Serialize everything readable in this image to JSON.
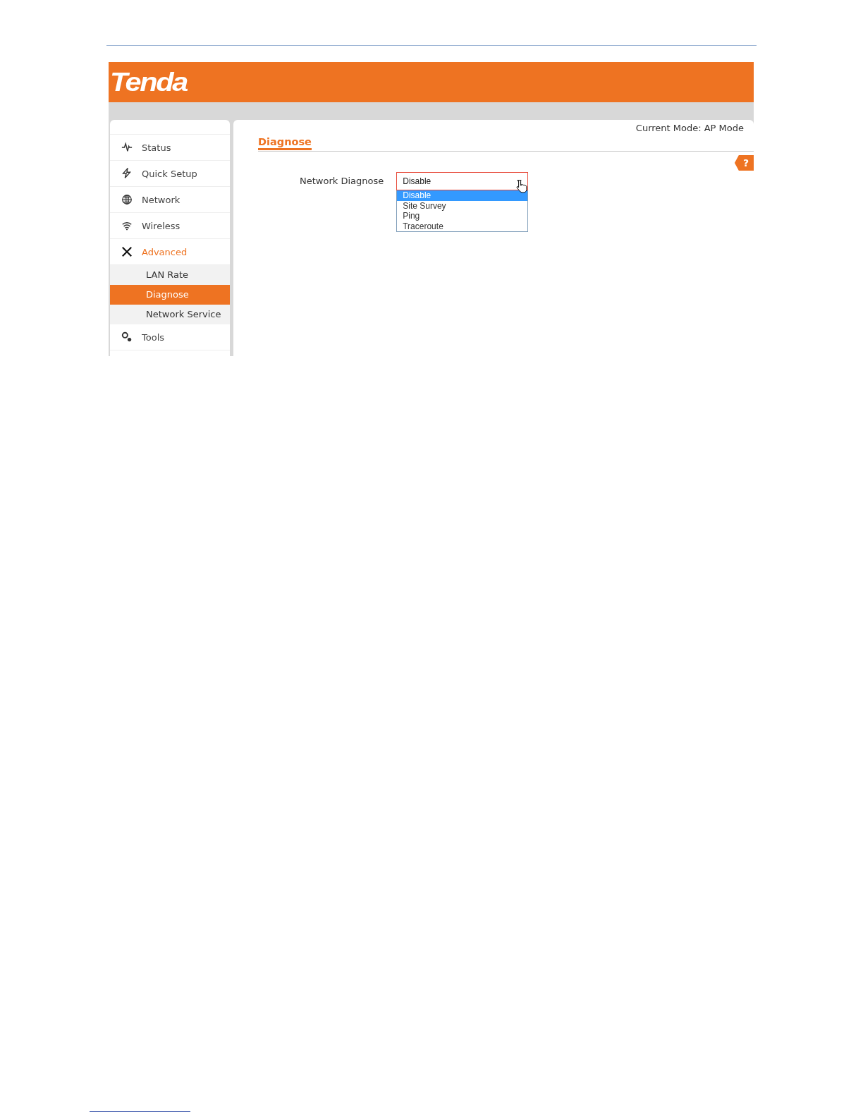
{
  "header": {
    "logo": "Tenda"
  },
  "sidebar": {
    "items": [
      {
        "label": "Status",
        "expanded": false
      },
      {
        "label": "Quick Setup",
        "expanded": false
      },
      {
        "label": "Network",
        "expanded": false
      },
      {
        "label": "Wireless",
        "expanded": false
      },
      {
        "label": "Advanced",
        "expanded": true,
        "children": [
          {
            "label": "LAN Rate",
            "selected": false
          },
          {
            "label": "Diagnose",
            "selected": true
          },
          {
            "label": "Network Service",
            "selected": false
          }
        ]
      },
      {
        "label": "Tools",
        "expanded": false
      }
    ]
  },
  "content": {
    "mode": "Current Mode: AP Mode",
    "title": "Diagnose",
    "help": "?",
    "field": {
      "label": "Network Diagnose",
      "value": "Disable",
      "open": true,
      "options": [
        {
          "label": "Disable",
          "selected": true
        },
        {
          "label": "Site Survey",
          "selected": false
        },
        {
          "label": "Ping",
          "selected": false
        },
        {
          "label": "Traceroute",
          "selected": false
        }
      ]
    }
  }
}
